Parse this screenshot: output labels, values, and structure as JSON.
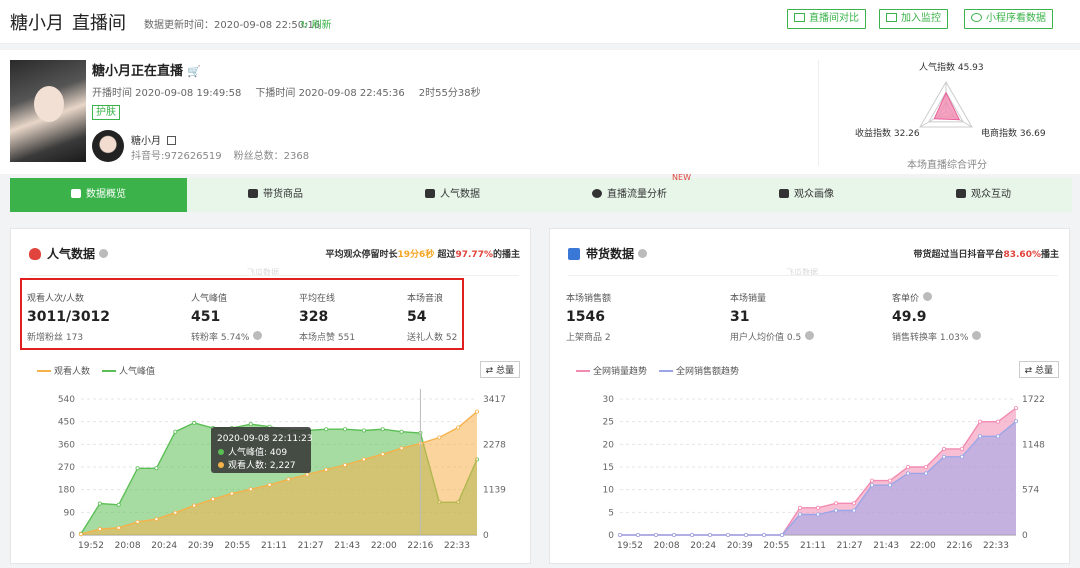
{
  "header": {
    "anchor": "糖小月",
    "page": "直播间",
    "update_label": "数据更新时间：2020-09-08 22:50:16",
    "refresh_label": "刷新",
    "buttons": [
      "直播间对比",
      "加入监控",
      "小程序看数据"
    ]
  },
  "live": {
    "title": "糖小月正在直播",
    "start": "开播时间 2020-09-08 19:49:58",
    "end": "下播时间 2020-09-08 22:45:36",
    "duration": "2时55分38秒",
    "tag": "护肤",
    "anchor_name": "糖小月",
    "douyin_id": "抖音号:972626519",
    "fans_total": "粉丝总数：2368"
  },
  "radar": {
    "popularity": "人气指数 45.93",
    "revenue": "收益指数 32.26",
    "ecommerce": "电商指数 36.69",
    "caption": "本场直播综合评分",
    "values": [
      45.93,
      36.69,
      32.26
    ],
    "colors": {
      "popularity": "#e8609a",
      "revenue": "#f5a623",
      "ecommerce": "#3bb34a"
    }
  },
  "tabs": [
    "数据概览",
    "带货商品",
    "人气数据",
    "直播流量分析",
    "观众画像",
    "观众互动"
  ],
  "tab_new": "NEW",
  "popularity": {
    "title": "人气数据",
    "note_pre": "平均观众停留时长",
    "note_time": "19分6秒",
    "note_mid": "超过",
    "note_pct": "97.77%",
    "note_post": "的播主",
    "watermark": "飞瓜数据",
    "stats": [
      {
        "label": "观看人次/人数",
        "value": "3011/3012",
        "sub": "新增粉丝 173"
      },
      {
        "label": "人气峰值",
        "value": "451",
        "sub": "转粉率 5.74%"
      },
      {
        "label": "平均在线",
        "value": "328",
        "sub": "本场点赞 551"
      },
      {
        "label": "本场音浪",
        "value": "54",
        "sub": "送礼人数 52"
      }
    ],
    "legend": [
      "观看人数",
      "人气峰值"
    ],
    "total_btn": "总量",
    "tooltip": {
      "time": "2020-09-08 22:11:23",
      "peak": "人气峰值: 409",
      "viewers": "观看人数: 2,227"
    }
  },
  "sales": {
    "title": "带货数据",
    "note_pre": "带货超过当日抖音平台",
    "note_pct": "83.60%",
    "note_post": "播主",
    "watermark": "飞瓜数据",
    "stats": [
      {
        "label": "本场销售额",
        "value": "1546",
        "sub": "上架商品 2"
      },
      {
        "label": "本场销量",
        "value": "31",
        "sub": "用户人均价值 0.5"
      },
      {
        "label": "客单价",
        "value": "49.9",
        "sub": "销售转换率 1.03%"
      }
    ],
    "legend": [
      "全网销量趋势",
      "全网销售额趋势"
    ],
    "total_btn": "总量"
  },
  "chart_data": [
    {
      "type": "area",
      "title": "",
      "x": [
        "19:52",
        "20:08",
        "20:24",
        "20:39",
        "20:55",
        "21:11",
        "21:27",
        "21:43",
        "22:00",
        "22:16",
        "22:33"
      ],
      "yleft_ticks": [
        0,
        90,
        180,
        270,
        360,
        450,
        540
      ],
      "yright_ticks": [
        0,
        1139,
        2278,
        3417
      ],
      "ylim_left": [
        0,
        540
      ],
      "ylim_right": [
        0,
        3417
      ],
      "series": [
        {
          "name": "人气峰值",
          "axis": "left",
          "color": "#5cbf56",
          "values": [
            5,
            125,
            120,
            265,
            265,
            410,
            445,
            425,
            425,
            440,
            430,
            415,
            415,
            420,
            420,
            415,
            420,
            410,
            405,
            130,
            130,
            300
          ]
        },
        {
          "name": "观看人数",
          "axis": "right",
          "color": "#f5b14a",
          "values": [
            20,
            150,
            180,
            330,
            400,
            560,
            740,
            900,
            1040,
            1150,
            1260,
            1400,
            1520,
            1640,
            1760,
            1900,
            2030,
            2180,
            2300,
            2450,
            2700,
            3100
          ]
        }
      ]
    },
    {
      "type": "area",
      "title": "",
      "x": [
        "19:52",
        "20:08",
        "20:24",
        "20:39",
        "20:55",
        "21:11",
        "21:27",
        "21:43",
        "22:00",
        "22:16",
        "22:33"
      ],
      "yleft_ticks": [
        0,
        5,
        10,
        15,
        20,
        25,
        30
      ],
      "yright_ticks": [
        0,
        574,
        1148,
        1722
      ],
      "ylim_left": [
        0,
        30
      ],
      "ylim_right": [
        0,
        1722
      ],
      "series": [
        {
          "name": "全网销量趋势",
          "axis": "left",
          "color": "#f28bb1",
          "values": [
            0,
            0,
            0,
            0,
            0,
            0,
            0,
            0,
            0,
            0,
            6,
            6,
            7,
            7,
            12,
            12,
            15,
            15,
            19,
            19,
            25,
            25,
            28
          ]
        },
        {
          "name": "全网销售额趋势",
          "axis": "right",
          "color": "#9aa6e8",
          "values": [
            0,
            0,
            0,
            0,
            0,
            0,
            0,
            0,
            0,
            0,
            260,
            260,
            310,
            310,
            630,
            630,
            780,
            780,
            990,
            990,
            1250,
            1250,
            1440
          ]
        }
      ]
    }
  ]
}
